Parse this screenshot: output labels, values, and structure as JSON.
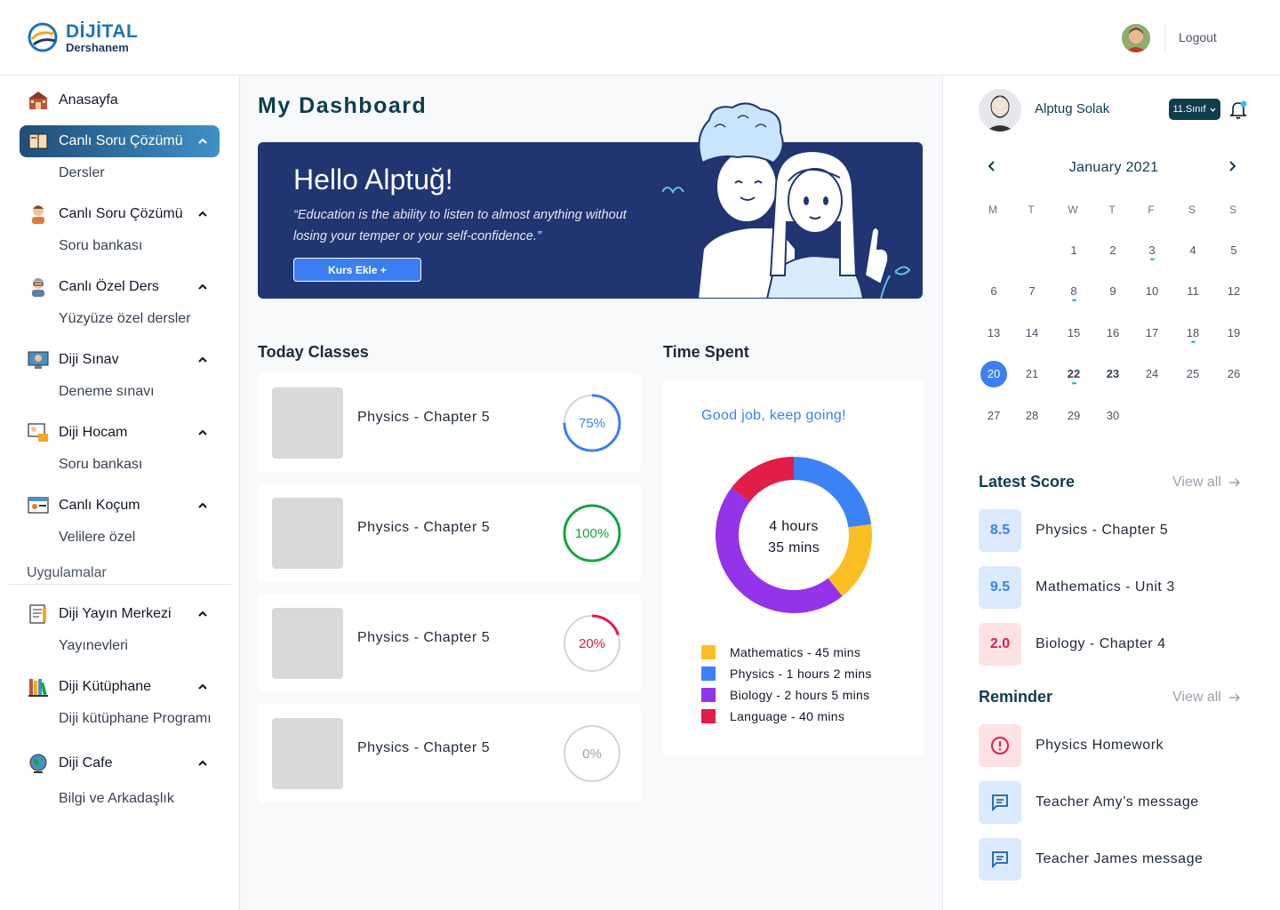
{
  "brand": {
    "line1": "DİJİTAL",
    "line2": "Dershanem"
  },
  "header": {
    "logout_label": "Logout"
  },
  "sidebar": {
    "items": [
      {
        "label": "Anasayfa",
        "sub": ""
      },
      {
        "label": "Canlı Soru Çözümü",
        "sub": "Dersler"
      },
      {
        "label": "Canlı Soru Çözümü",
        "sub": "Soru bankası"
      },
      {
        "label": "Canlı Özel Ders",
        "sub": "Yüzyüze özel dersler"
      },
      {
        "label": "Diji Sınav",
        "sub": "Deneme sınavı"
      },
      {
        "label": "Diji Hocam",
        "sub": "Soru bankası"
      },
      {
        "label": "Canlı Koçum",
        "sub": "Velilere özel"
      },
      {
        "label": "Diji Yayın Merkezi",
        "sub": "Yayınevleri"
      },
      {
        "label": "Diji Kütüphane",
        "sub": "Diji kütüphane Programı"
      },
      {
        "label": "Diji Cafe",
        "sub": "Bilgi ve Arkadaşlık"
      }
    ],
    "section_label": "Uygulamalar"
  },
  "main": {
    "title": "My Dashboard",
    "hero": {
      "greeting": "Hello Alptuğ!",
      "quote": "“Education is the ability to listen to almost anything without losing your temper or your self-confidence.”",
      "button_label": "Kurs Ekle  +"
    },
    "today_classes_title": "Today Classes",
    "classes": [
      {
        "title": "Physics - Chapter 5",
        "progress_label": "75%",
        "progress": 75,
        "color": "#3b7ff2"
      },
      {
        "title": "Physics - Chapter 5",
        "progress_label": "100%",
        "progress": 100,
        "color": "#16a34a"
      },
      {
        "title": "Physics - Chapter 5",
        "progress_label": "20%",
        "progress": 20,
        "color": "#e11d48"
      },
      {
        "title": "Physics - Chapter 5",
        "progress_label": "0%",
        "progress": 0,
        "color": "#d1d5db"
      }
    ],
    "time_spent": {
      "title": "Time Spent",
      "message": "Good job, keep going!",
      "total_line1": "4 hours",
      "total_line2": "35 mins",
      "legend": [
        {
          "label": "Mathematics - 45 mins",
          "color": "#fbbf24",
          "minutes": 45
        },
        {
          "label": "Physics - 1 hours 2 mins",
          "color": "#3b82f6",
          "minutes": 62
        },
        {
          "label": "Biology - 2 hours 5 mins",
          "color": "#9333ea",
          "minutes": 125
        },
        {
          "label": "Language - 40 mins",
          "color": "#e11d48",
          "minutes": 40
        }
      ]
    }
  },
  "profile": {
    "name": "Alptug Solak",
    "grade": "11.Sınıf"
  },
  "calendar": {
    "month": "January 2021",
    "dow": [
      "M",
      "T",
      "W",
      "T",
      "F",
      "S",
      "S"
    ],
    "weeks": [
      [
        "",
        "",
        "1",
        "2",
        "3",
        "4",
        "5"
      ],
      [
        "6",
        "7",
        "8",
        "9",
        "10",
        "11",
        "12"
      ],
      [
        "13",
        "14",
        "15",
        "16",
        "17",
        "18",
        "19"
      ],
      [
        "20",
        "21",
        "22",
        "23",
        "24",
        "25",
        "26"
      ],
      [
        "27",
        "28",
        "29",
        "30",
        "",
        "",
        ""
      ]
    ],
    "selected": "20",
    "bold_days": [
      "22",
      "23"
    ],
    "dot_days": [
      "3",
      "8",
      "18",
      "22"
    ]
  },
  "latest_score": {
    "title": "Latest Score",
    "view_all": "View all",
    "items": [
      {
        "score": "8.5",
        "label": "Physics - Chapter 5",
        "bg": "#dbeafe",
        "fg": "#3b7ff2"
      },
      {
        "score": "9.5",
        "label": "Mathematics - Unit 3",
        "bg": "#dbeafe",
        "fg": "#3b7ff2"
      },
      {
        "score": "2.0",
        "label": "Biology - Chapter 4",
        "bg": "#fde2e4",
        "fg": "#e11d48"
      }
    ]
  },
  "reminder": {
    "title": "Reminder",
    "view_all": "View all",
    "items": [
      {
        "label": "Physics Homework",
        "icon": "alert-icon"
      },
      {
        "label": "Teacher Amy’s message",
        "icon": "message-icon"
      },
      {
        "label": "Teacher James message",
        "icon": "message-icon"
      }
    ]
  }
}
